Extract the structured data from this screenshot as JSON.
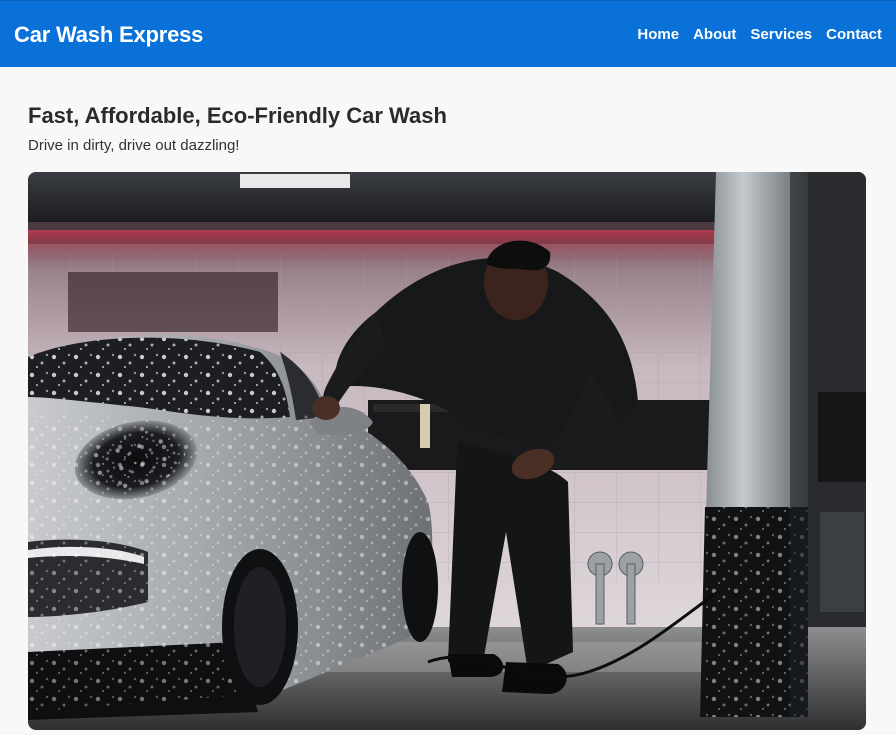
{
  "header": {
    "brand": "Car Wash Express",
    "nav": [
      "Home",
      "About",
      "Services",
      "Contact"
    ],
    "background_color": "#0a71d8"
  },
  "hero": {
    "title": "Fast, Affordable, Eco-Friendly Car Wash",
    "subtitle": "Drive in dirty, drive out dazzling!"
  }
}
